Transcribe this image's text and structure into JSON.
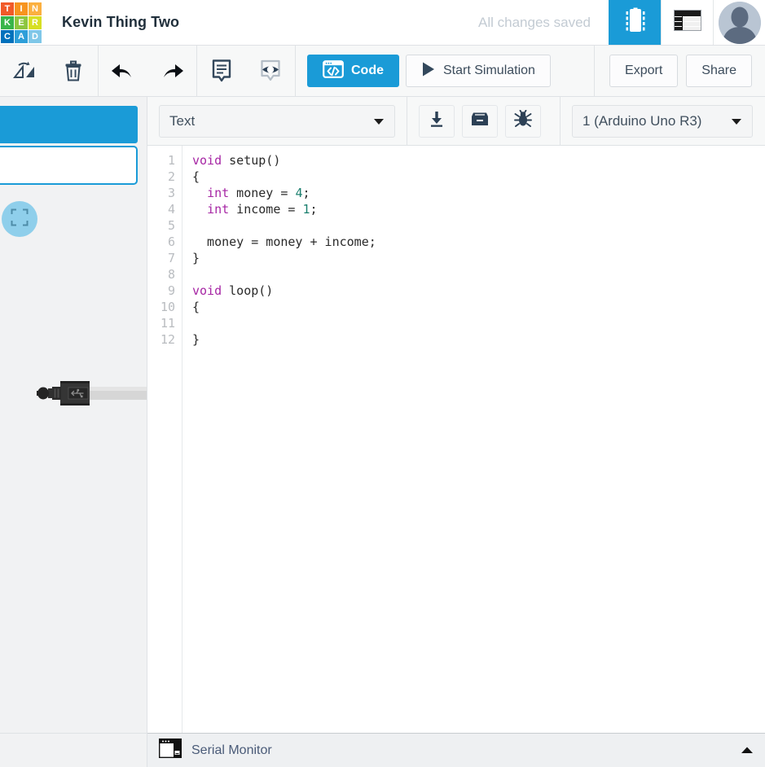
{
  "topbar": {
    "logo_tiles": [
      {
        "letter": "T",
        "color": "#f15a29"
      },
      {
        "letter": "I",
        "color": "#f7941e"
      },
      {
        "letter": "N",
        "color": "#fbb040"
      },
      {
        "letter": "K",
        "color": "#39b54a"
      },
      {
        "letter": "E",
        "color": "#8dc63f"
      },
      {
        "letter": "R",
        "color": "#d7df23"
      },
      {
        "letter": "C",
        "color": "#0071bc"
      },
      {
        "letter": "A",
        "color": "#2e9fd9"
      },
      {
        "letter": "D",
        "color": "#7fc7e8"
      }
    ],
    "logo_name": "tinkercad-logo",
    "doc_title": "Kevin Thing Two",
    "saved_status": "All changes saved",
    "tab_components_icon": "ic-chip-icon",
    "tab_list_icon": "components-list-icon",
    "avatar_icon": "user-avatar"
  },
  "toolbar": {
    "rotate_icon": "rotate-flip-icon",
    "delete_icon": "trash-icon",
    "undo_icon": "undo-arrow-icon",
    "redo_icon": "redo-arrow-icon",
    "notes_icon": "notes-icon",
    "visibility_icon": "eye-visibility-icon",
    "code_label": "Code",
    "code_icon": "code-window-icon",
    "simulation_label": "Start Simulation",
    "simulation_icon": "play-icon",
    "export_label": "Export",
    "share_label": "Share"
  },
  "canvas": {
    "fit_view_icon": "fit-to-view-icon",
    "component_name": "usb-cable-connector"
  },
  "code_header": {
    "language": "Text",
    "language_caret_icon": "chevron-down-icon",
    "download_icon": "download-icon",
    "library_icon": "library-archive-icon",
    "debug_icon": "debug-bug-icon",
    "board": "1 (Arduino Uno R3)",
    "board_caret_icon": "chevron-down-icon"
  },
  "editor": {
    "line_numbers": "1\n2\n3\n4\n5\n6\n7\n8\n9\n10\n11\n12",
    "lines": [
      {
        "tokens": [
          {
            "t": "void",
            "c": "kw"
          },
          {
            "t": " setup()",
            "c": ""
          }
        ]
      },
      {
        "tokens": [
          {
            "t": "{",
            "c": ""
          }
        ]
      },
      {
        "tokens": [
          {
            "t": "  ",
            "c": ""
          },
          {
            "t": "int",
            "c": "kw"
          },
          {
            "t": " money = ",
            "c": ""
          },
          {
            "t": "4",
            "c": "num"
          },
          {
            "t": ";",
            "c": ""
          }
        ]
      },
      {
        "tokens": [
          {
            "t": "  ",
            "c": ""
          },
          {
            "t": "int",
            "c": "kw"
          },
          {
            "t": " income = ",
            "c": ""
          },
          {
            "t": "1",
            "c": "num"
          },
          {
            "t": ";",
            "c": ""
          }
        ]
      },
      {
        "tokens": [
          {
            "t": "",
            "c": ""
          }
        ]
      },
      {
        "tokens": [
          {
            "t": "  money = money + income;",
            "c": ""
          }
        ]
      },
      {
        "tokens": [
          {
            "t": "}",
            "c": ""
          }
        ]
      },
      {
        "tokens": [
          {
            "t": "",
            "c": ""
          }
        ]
      },
      {
        "tokens": [
          {
            "t": "void",
            "c": "kw"
          },
          {
            "t": " loop()",
            "c": ""
          }
        ]
      },
      {
        "tokens": [
          {
            "t": "{",
            "c": ""
          }
        ]
      },
      {
        "tokens": [
          {
            "t": "",
            "c": ""
          }
        ]
      },
      {
        "tokens": [
          {
            "t": "}",
            "c": ""
          }
        ]
      }
    ]
  },
  "serial_monitor": {
    "label": "Serial Monitor",
    "icon": "serial-window-icon",
    "expand_icon": "chevron-up-icon"
  },
  "colors": {
    "accent_blue": "#1a9bd7",
    "text_dark": "#21303c",
    "muted": "#c3cbd3",
    "keyword": "#a626a4",
    "number": "#1a7f6e"
  }
}
